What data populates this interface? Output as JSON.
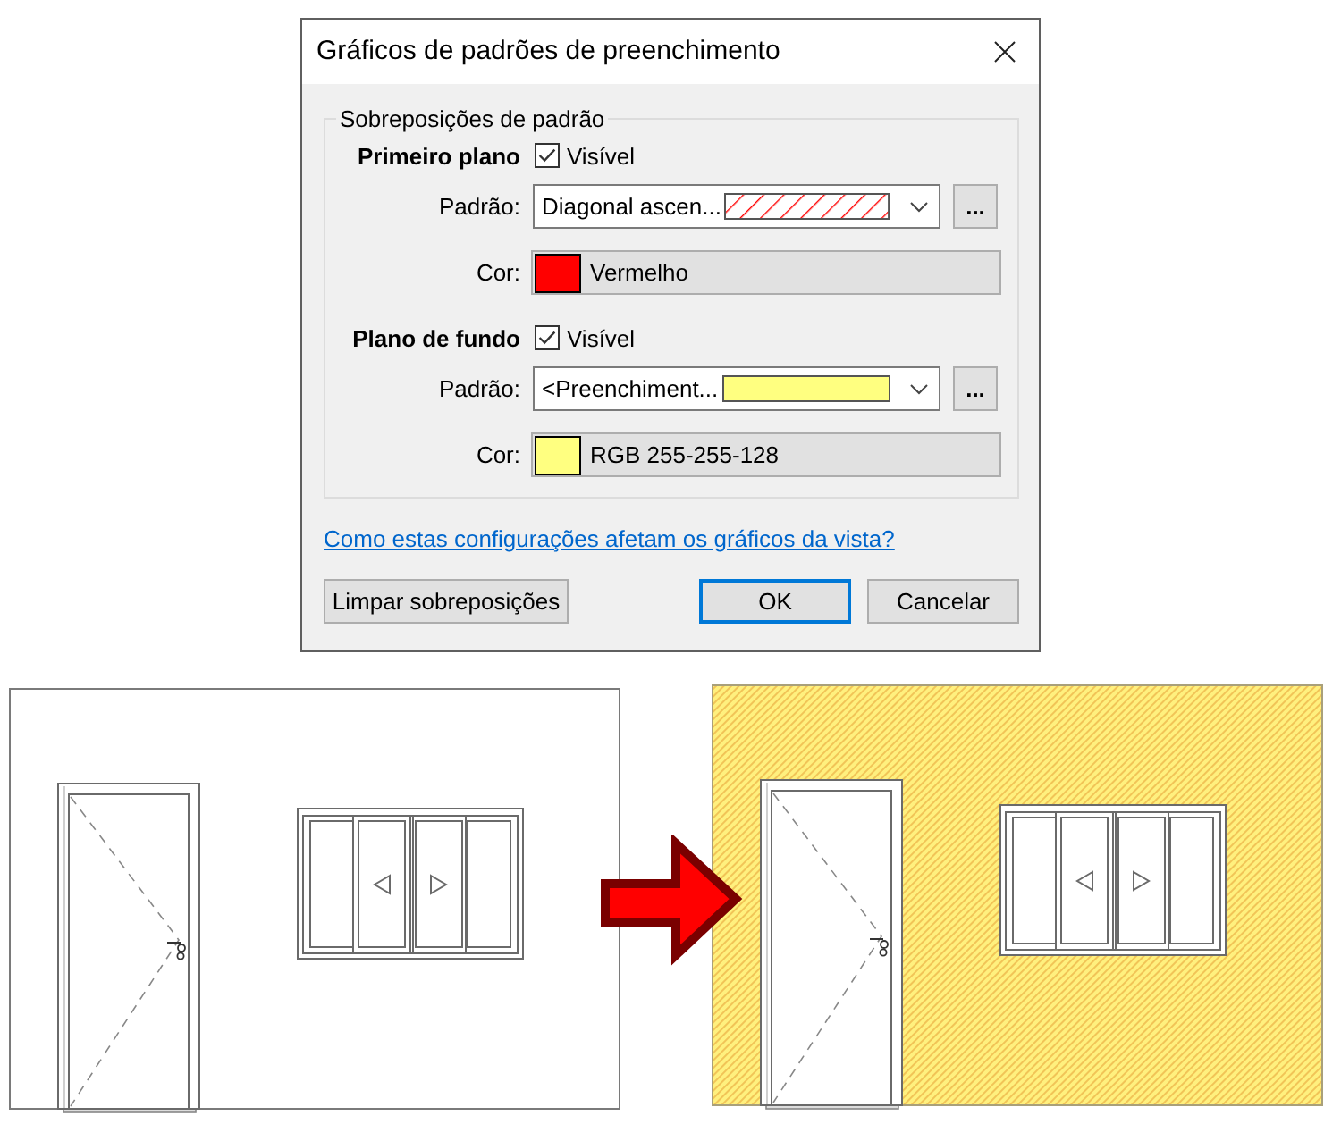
{
  "window": {
    "title": "Gráficos de padrões de preenchimento"
  },
  "overrides": {
    "title": "Sobreposições de padrão",
    "sections": [
      {
        "heading": "Primeiro plano",
        "checkbox_label": "Visível",
        "checked": true,
        "pattern_label": "Padrão:",
        "pattern": {
          "value": "Diagonal ascen...",
          "kind": "hatch"
        },
        "browse_label": "...",
        "color_label": "Cor:",
        "color_name": "Vermelho",
        "color": "#ff0000"
      },
      {
        "heading": "Plano de fundo",
        "checkbox_label": "Visível",
        "checked": true,
        "pattern_label": "Padrão:",
        "pattern": {
          "value": "<Preenchiment...",
          "kind": "solid"
        },
        "browse_label": "...",
        "color_label": "Cor:",
        "color_name": "RGB 255-255-128",
        "color": "#ffff80"
      }
    ]
  },
  "help_link": "Como estas configurações afetam os gráficos da vista?",
  "clear_button": {
    "label": "Limpar sobreposições"
  },
  "buttons": [
    {
      "label": "OK",
      "default": true
    },
    {
      "label": "Cancelar",
      "default": false
    }
  ]
}
